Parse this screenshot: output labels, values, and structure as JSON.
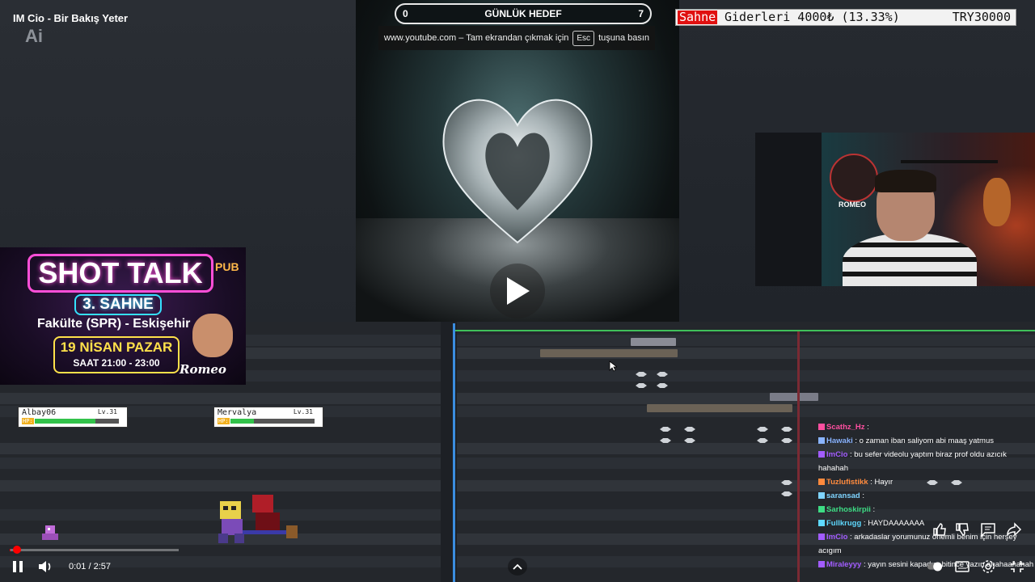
{
  "window": {
    "title": "IM Cio - Bir Bakış Yeter",
    "logo": "Ai"
  },
  "goal_bar": {
    "left": "0",
    "title": "GÜNLÜK HEDEF",
    "right": "7"
  },
  "fullscreen_toast": {
    "before": "www.youtube.com – Tam ekrandan çıkmak için",
    "key": "Esc",
    "after": "tuşuna basın"
  },
  "donation_bar": {
    "tag": "Sahne",
    "text": "Giderleri 4000₺ (13.33%)",
    "target": "TRY30000"
  },
  "poster": {
    "title": "SHOT TALK",
    "stage": "3. SAHNE",
    "place": "Fakülte (SPR) - Eskişehir",
    "date": "19 NİSAN PAZAR",
    "time": "SAAT 21:00 - 23:00",
    "pub": "PUB",
    "signature": "Romeo"
  },
  "webcam": {
    "badge": "ROMEO"
  },
  "game": {
    "players": [
      {
        "name": "Albay06",
        "level": "Lv.31",
        "hp_label": "HP:",
        "hp": 0.72
      },
      {
        "name": "Mervalya",
        "level": "Lv.31",
        "hp_label": "HP:",
        "hp": 0.28
      }
    ]
  },
  "chat": [
    {
      "user": "Scathz_Hz",
      "color": "#ff4fa0",
      "message": " : "
    },
    {
      "user": "Hawaki",
      "color": "#8ab4ff",
      "message": " : o zaman iban saliyom abi maaş yatmus"
    },
    {
      "user": "ImCio",
      "color": "#a25cff",
      "message": " : bu sefer videolu yaptım biraz prof oldu azıcık hahahah"
    },
    {
      "user": "Tuzlufistikk",
      "color": "#ff8a3d",
      "message": " : Hayır"
    },
    {
      "user": "saransad",
      "color": "#7fd4ff",
      "message": " : "
    },
    {
      "user": "Sarhoskirpii",
      "color": "#3ddc84",
      "message": " : "
    },
    {
      "user": "Fullkrugg",
      "color": "#5fd9ff",
      "message": " : HAYDAAAAAAA"
    },
    {
      "user": "ImCio",
      "color": "#a25cff",
      "message": " : arkadaslar yorumunuz önemli benim için herşey acıgım"
    },
    {
      "user": "Miraleyyy",
      "color": "#a25cff",
      "message": " : yayın sesini kapadım bitince yazın ahahaahahah"
    }
  ],
  "player": {
    "time": "0:01 / 2:57",
    "progress": 0.0057
  },
  "icons": [
    "pause-icon",
    "volume-icon",
    "chevron-up-icon",
    "like-icon",
    "dislike-icon",
    "comment-icon",
    "share-icon",
    "autoplay-icon",
    "subtitles-icon",
    "settings-icon",
    "fullscreen-exit-icon",
    "play-icon"
  ]
}
